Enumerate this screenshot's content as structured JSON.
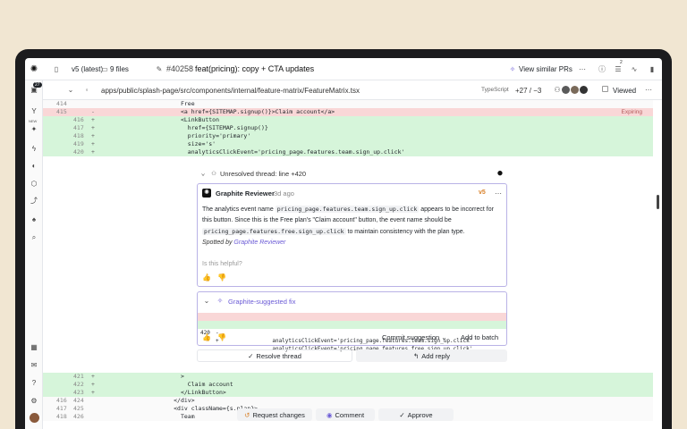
{
  "topbar": {
    "version": "v5 (latest)",
    "files": "9 files",
    "pr_number": "#40258",
    "pr_title": "feat(pricing): copy + CTA updates",
    "view_similar": "View similar PRs",
    "notif_count": "2"
  },
  "sidebar": {
    "badge": "27",
    "new_label": "NEW"
  },
  "filebar": {
    "path": "apps/public/splash-page/src/components/internal/feature-matrix/FeatureMatrix.tsx",
    "lang": "TypeScript",
    "diffstat": "+27 / −3",
    "viewed": "Viewed"
  },
  "code_top": [
    {
      "ln1": "414",
      "ln2": "",
      "sign": "",
      "type": "ctx",
      "text": "            Free"
    },
    {
      "ln1": "415",
      "ln2": "",
      "sign": "-",
      "type": "del",
      "text": "            <a href={SITEMAP.signup()}>Claim account</a>",
      "tail": "Expiring"
    },
    {
      "ln1": "",
      "ln2": "416",
      "sign": "+",
      "type": "add",
      "text": "            <LinkButton"
    },
    {
      "ln1": "",
      "ln2": "417",
      "sign": "+",
      "type": "add",
      "text": "              href={SITEMAP.signup()}"
    },
    {
      "ln1": "",
      "ln2": "418",
      "sign": "+",
      "type": "add",
      "text": "              priority='primary'"
    },
    {
      "ln1": "",
      "ln2": "419",
      "sign": "+",
      "type": "add",
      "text": "              size='s'"
    },
    {
      "ln1": "",
      "ln2": "420",
      "sign": "+",
      "type": "add",
      "text": "              analyticsClickEvent='pricing_page.features.team.sign_up.click'"
    }
  ],
  "code_bottom": [
    {
      "ln1": "",
      "ln2": "421",
      "sign": "+",
      "type": "add",
      "text": "            >"
    },
    {
      "ln1": "",
      "ln2": "422",
      "sign": "+",
      "type": "add",
      "text": "              Claim account"
    },
    {
      "ln1": "",
      "ln2": "423",
      "sign": "+",
      "type": "add",
      "text": "            </LinkButton>"
    },
    {
      "ln1": "416",
      "ln2": "424",
      "sign": "",
      "type": "ctx",
      "text": "          </div>"
    },
    {
      "ln1": "417",
      "ln2": "425",
      "sign": "",
      "type": "ctx",
      "text": "          <div className={s.plan}>"
    },
    {
      "ln1": "418",
      "ln2": "426",
      "sign": "",
      "type": "ctx",
      "text": "            Team"
    }
  ],
  "thread": {
    "header": "Unresolved thread: line +420",
    "author": "Graphite Reviewer",
    "time": "3d ago",
    "version_tag": "v5",
    "body_1": "The analytics event name",
    "code_1": "pricing_page.features.team.sign_up.click",
    "body_2": "appears to be incorrect for this",
    "body_3": "button. Since this is the Free plan's \"Claim account\" button, the event name should be",
    "code_2": "pricing_page.features.free.sign_up.click",
    "body_4": "to maintain consistency with the plan type.",
    "spotted_by": "Spotted by",
    "spotted_link": "Graphite Reviewer",
    "helpful": "Is this helpful?",
    "fix_title": "Graphite-suggested fix",
    "fix_del_ln": "420",
    "fix_del_sign": "-",
    "fix_del": "            analyticsClickEvent='pricing_page.features.team.sign_up.click'",
    "fix_add_ln": "420",
    "fix_add_sign": "+",
    "fix_add": "            analyticsClickEvent='pricing_page.features.free.sign_up.click'",
    "commit": "Commit suggestion",
    "add_batch": "Add to batch",
    "resolve": "Resolve thread",
    "reply": "Add reply"
  },
  "actions": {
    "request": "Request changes",
    "comment": "Comment",
    "approve": "Approve"
  },
  "colors": {
    "add_bg": "#d6f5da",
    "del_bg": "#f9d7d7",
    "accent": "#6b5bd6"
  }
}
